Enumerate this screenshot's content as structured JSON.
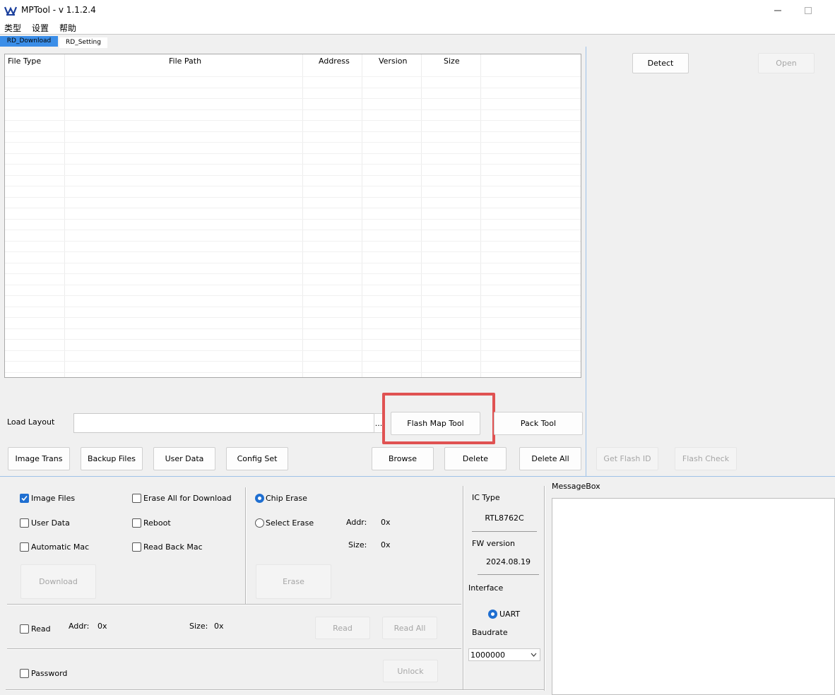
{
  "window": {
    "title": "MPTool - v 1.1.2.4"
  },
  "menu": [
    "类型",
    "设置",
    "帮助"
  ],
  "tabs": [
    "RD_Download",
    "RD_Setting"
  ],
  "table": {
    "headers": [
      "File Type",
      "File Path",
      "Address",
      "Version",
      "Size"
    ]
  },
  "layout": {
    "load_layout_label": "Load Layout",
    "load_layout_value": "",
    "browse_dots": "..."
  },
  "buttons": {
    "flash_map_tool": "Flash Map Tool",
    "pack_tool": "Pack Tool",
    "image_trans": "Image Trans",
    "backup_files": "Backup Files",
    "user_data": "User Data",
    "config_set": "Config Set",
    "browse": "Browse",
    "delete": "Delete",
    "delete_all": "Delete All",
    "detect": "Detect",
    "open": "Open",
    "get_flash_id": "Get Flash ID",
    "flash_check": "Flash Check",
    "download": "Download",
    "erase": "Erase",
    "read": "Read",
    "read_all": "Read All",
    "unlock": "Unlock"
  },
  "options": {
    "image_files": "Image Files",
    "erase_all_for_download": "Erase All for Download",
    "user_data": "User Data",
    "reboot": "Reboot",
    "automatic_mac": "Automatic Mac",
    "read_back_mac": "Read Back Mac"
  },
  "erase": {
    "chip_erase": "Chip Erase",
    "select_erase": "Select Erase",
    "addr_label": "Addr:",
    "addr_value": "0x",
    "size_label": "Size:",
    "size_value": "0x"
  },
  "read": {
    "read_label": "Read",
    "addr_label": "Addr:",
    "addr_value": "0x",
    "size_label": "Size:",
    "size_value": "0x"
  },
  "password": {
    "label": "Password"
  },
  "ic": {
    "ic_type_label": "IC Type",
    "ic_type_value": "RTL8762C",
    "fw_version_label": "FW version",
    "fw_version_value": "2024.08.19",
    "interface_label": "Interface",
    "uart_label": "UART",
    "baudrate_label": "Baudrate",
    "baudrate_value": "1000000"
  },
  "messagebox": {
    "label": "MessageBox"
  },
  "colors": {
    "accent": "#1f6fd1",
    "tab_active": "#3b8ee8",
    "highlight": "#e05252"
  }
}
